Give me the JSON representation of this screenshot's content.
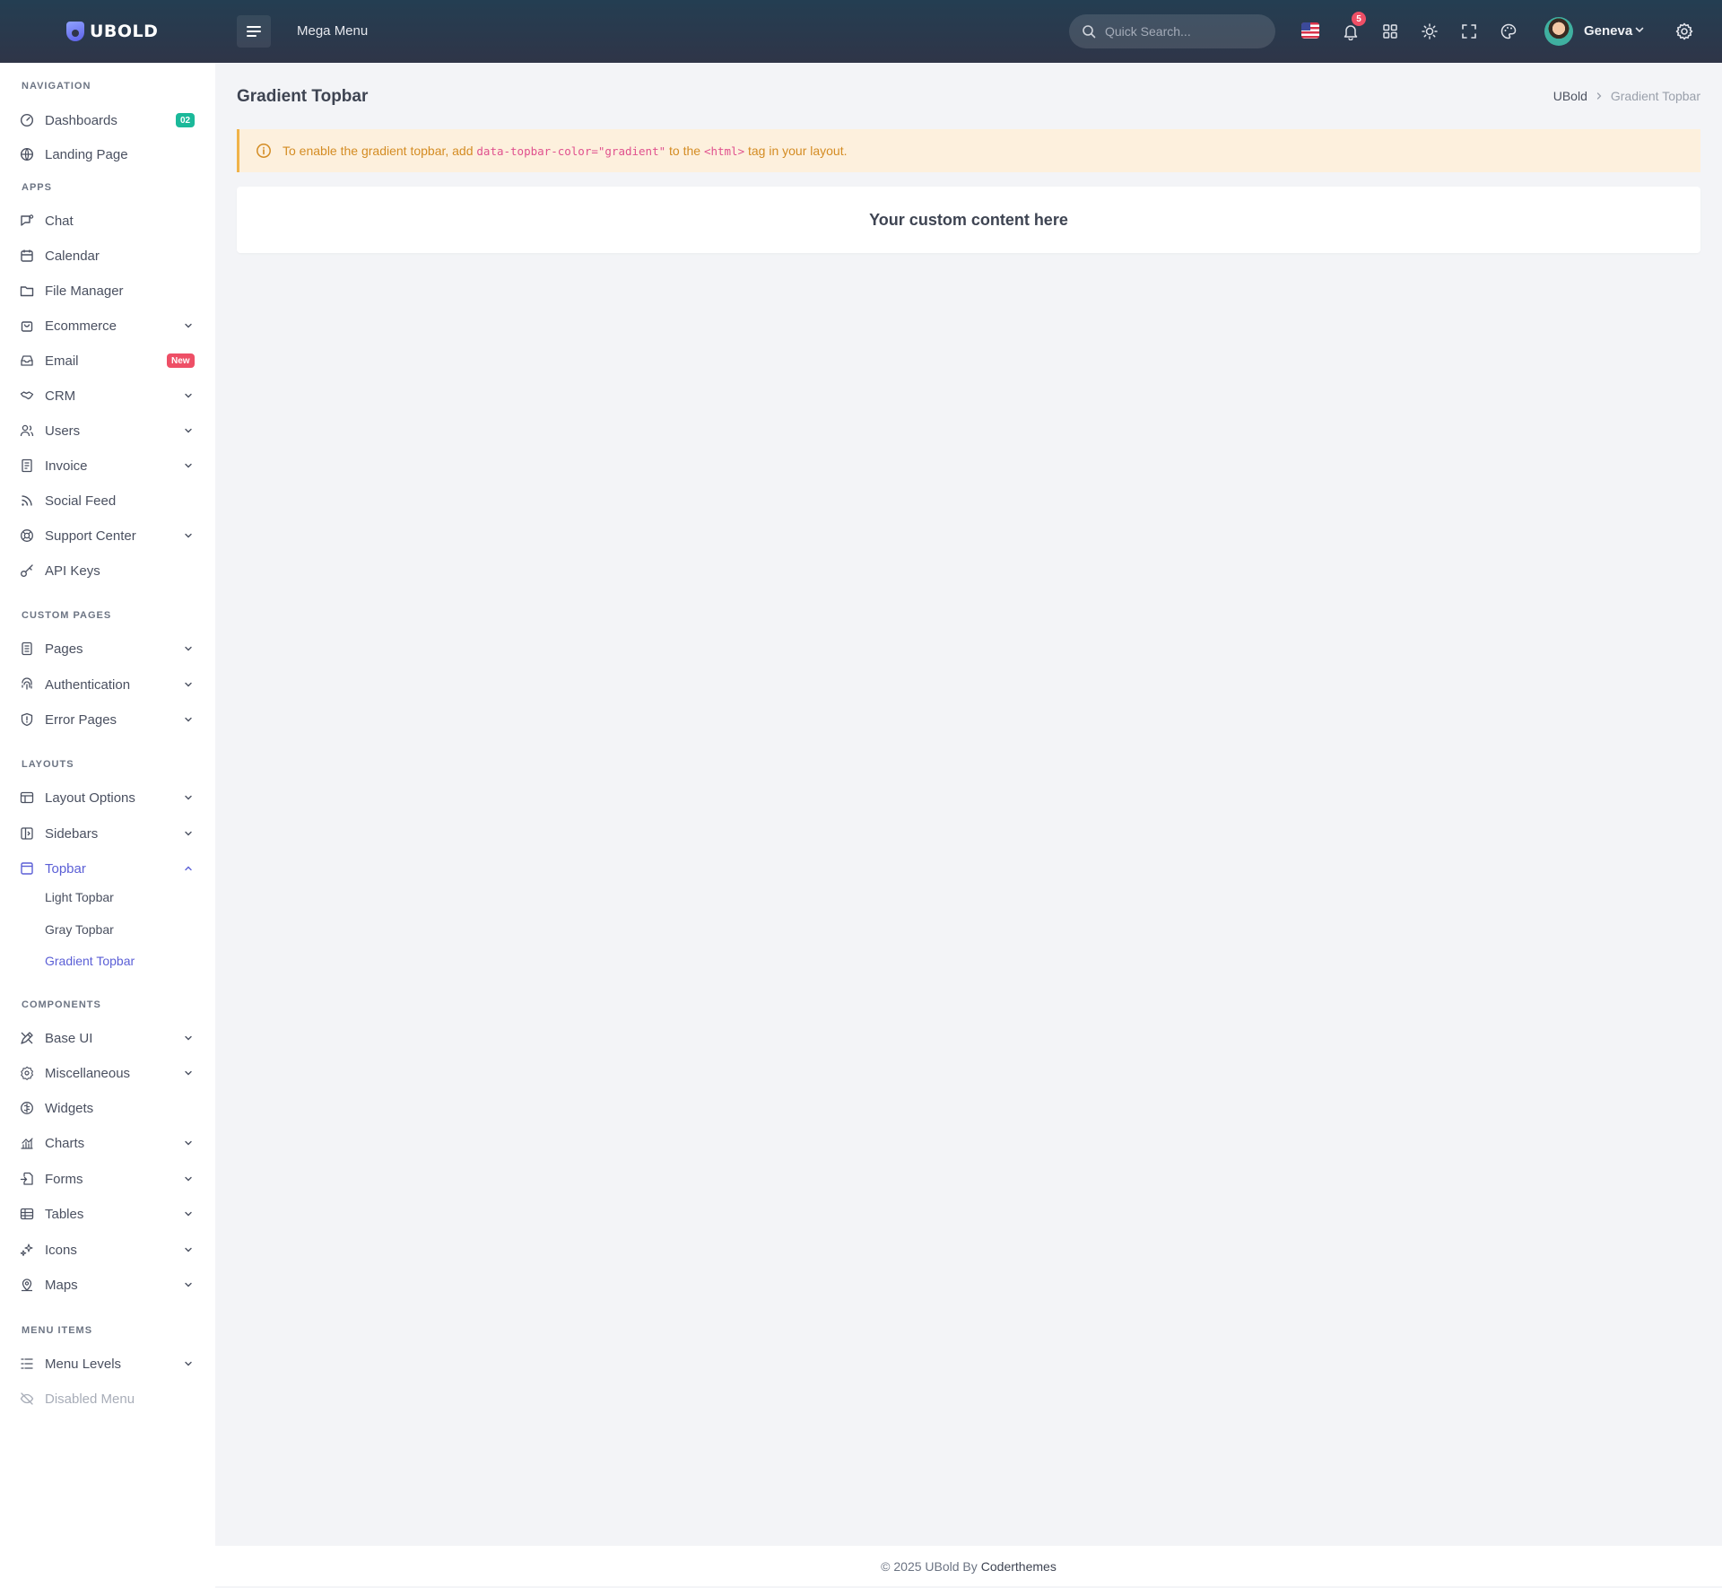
{
  "topbar": {
    "logo_text": "UBOLD",
    "mega_menu_label": "Mega Menu",
    "search_placeholder": "Quick Search...",
    "notification_count": "5",
    "user_name": "Geneva"
  },
  "sidebar": {
    "sections": {
      "navigation": "NAVIGATION",
      "apps": "APPS",
      "custom_pages": "CUSTOM PAGES",
      "layouts": "LAYOUTS",
      "components": "COMPONENTS",
      "menu_items": "MENU ITEMS"
    },
    "items": {
      "dashboards": {
        "label": "Dashboards",
        "badge": "02"
      },
      "landing_page": {
        "label": "Landing Page"
      },
      "chat": {
        "label": "Chat"
      },
      "calendar": {
        "label": "Calendar"
      },
      "file_manager": {
        "label": "File Manager"
      },
      "ecommerce": {
        "label": "Ecommerce"
      },
      "email": {
        "label": "Email",
        "badge": "New"
      },
      "crm": {
        "label": "CRM"
      },
      "users": {
        "label": "Users"
      },
      "invoice": {
        "label": "Invoice"
      },
      "social_feed": {
        "label": "Social Feed"
      },
      "support_center": {
        "label": "Support Center"
      },
      "api_keys": {
        "label": "API Keys"
      },
      "pages": {
        "label": "Pages"
      },
      "authentication": {
        "label": "Authentication"
      },
      "error_pages": {
        "label": "Error Pages"
      },
      "layout_options": {
        "label": "Layout Options"
      },
      "sidebars": {
        "label": "Sidebars"
      },
      "topbar": {
        "label": "Topbar",
        "sub": [
          "Light Topbar",
          "Gray Topbar",
          "Gradient Topbar"
        ]
      },
      "base_ui": {
        "label": "Base UI"
      },
      "miscellaneous": {
        "label": "Miscellaneous"
      },
      "widgets": {
        "label": "Widgets"
      },
      "charts": {
        "label": "Charts"
      },
      "forms": {
        "label": "Forms"
      },
      "tables": {
        "label": "Tables"
      },
      "icons": {
        "label": "Icons"
      },
      "maps": {
        "label": "Maps"
      },
      "menu_levels": {
        "label": "Menu Levels"
      },
      "disabled_menu": {
        "label": "Disabled Menu"
      }
    }
  },
  "main": {
    "page_title": "Gradient Topbar",
    "breadcrumb": {
      "root": "UBold",
      "current": "Gradient Topbar"
    },
    "alert": {
      "text_before": "To enable the gradient topbar, add ",
      "code_attr": "data-topbar-color=\"gradient\"",
      "text_middle": " to the ",
      "code_tag": "<html>",
      "text_after": " tag in your layout."
    },
    "card_text": "Your custom content here"
  },
  "footer": {
    "text": "© 2025 UBold By",
    "brand": "Coderthemes"
  },
  "colors": {
    "accent": "#5b5fd6",
    "alert_bg": "#fdf0dd",
    "alert_text": "#d48c23",
    "badge_teal": "#1bb99a",
    "badge_red": "#ee4f66"
  }
}
